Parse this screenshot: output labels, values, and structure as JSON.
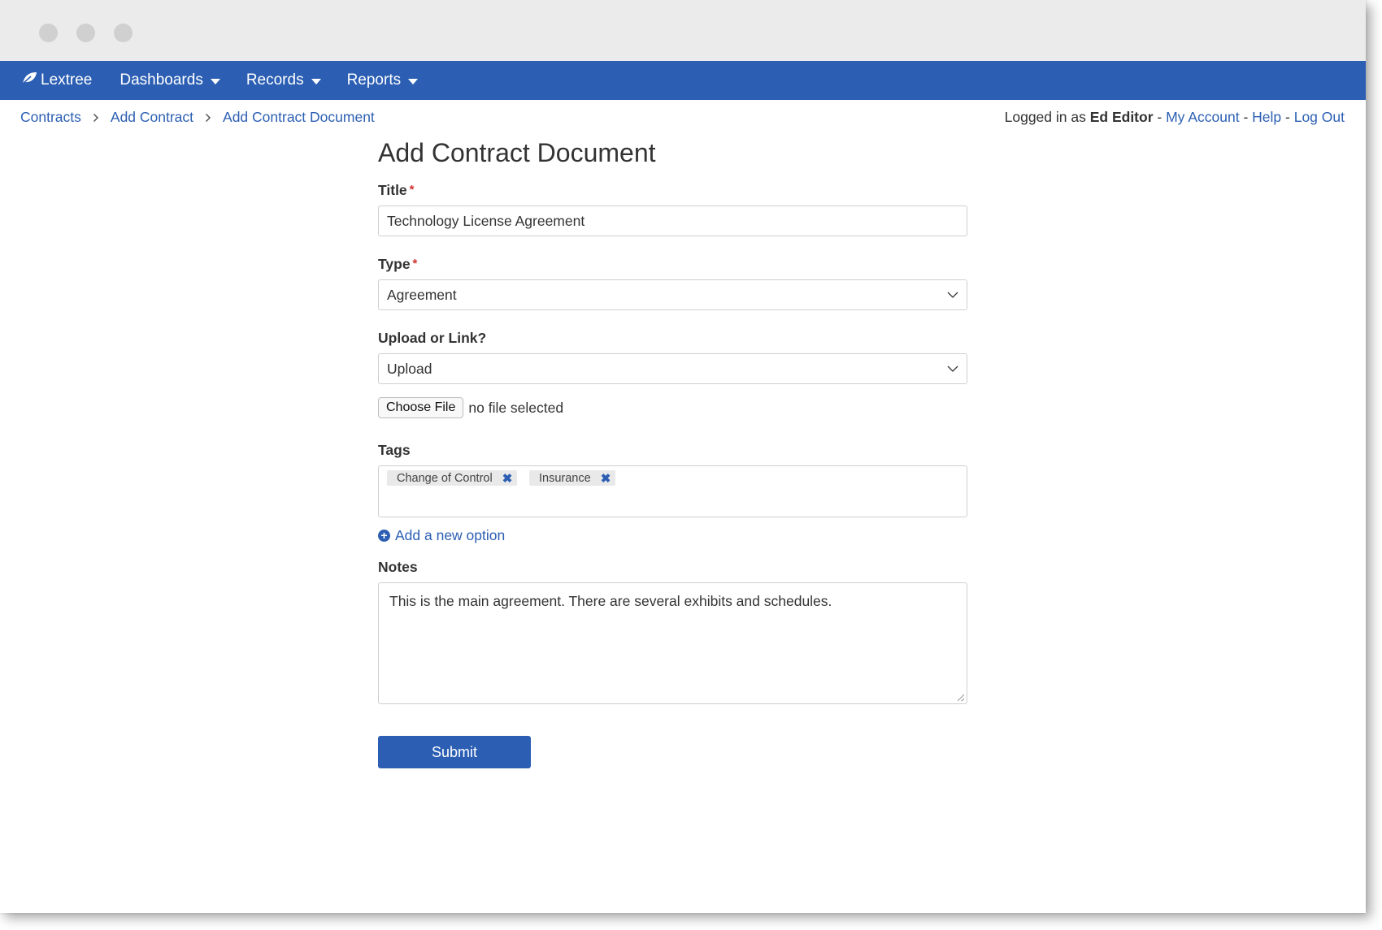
{
  "nav": {
    "brand": "Lextree",
    "items": [
      {
        "label": "Dashboards"
      },
      {
        "label": "Records"
      },
      {
        "label": "Reports"
      }
    ]
  },
  "breadcrumb": [
    "Contracts",
    "Add Contract",
    "Add Contract Document"
  ],
  "user": {
    "prefix": "Logged in as",
    "name": "Ed Editor",
    "separator": "-",
    "my_account": "My Account",
    "help": "Help",
    "log_out": "Log Out"
  },
  "form": {
    "heading": "Add Contract Document",
    "title_label": "Title",
    "title_value": "Technology License Agreement",
    "required_mark": "*",
    "type_label": "Type",
    "type_value": "Agreement",
    "upload_label": "Upload or Link?",
    "upload_value": "Upload",
    "choose_file": "Choose File",
    "no_file": "no file selected",
    "tags_label": "Tags",
    "tags": [
      {
        "label": "Change of Control"
      },
      {
        "label": "Insurance"
      }
    ],
    "tag_remove": "✖",
    "add_option": "Add a new option",
    "notes_label": "Notes",
    "notes_value": "This is the main agreement. There are several exhibits and schedules.",
    "submit": "Submit"
  },
  "colors": {
    "primary": "#2c5fb3",
    "required": "#d32f2f",
    "titlebar": "#ebebeb"
  }
}
